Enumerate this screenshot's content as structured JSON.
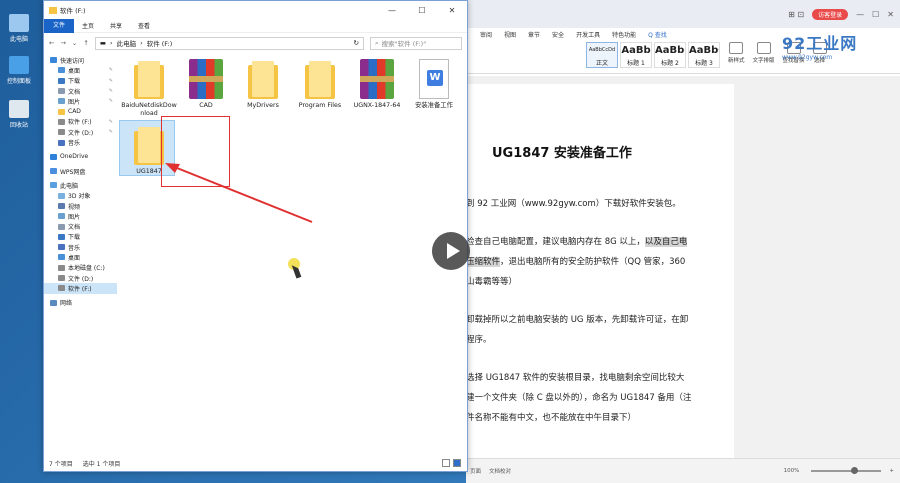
{
  "desktop": {
    "icons": [
      {
        "label": "此电脑",
        "color": "#9cc7ef"
      },
      {
        "label": "控制面板",
        "color": "#4aa0e6"
      },
      {
        "label": "回收站",
        "color": "#dfe8ef"
      }
    ]
  },
  "explorer": {
    "title": "软件 (F:)",
    "window_controls": [
      "—",
      "☐",
      "✕"
    ],
    "ribbon_tabs": [
      "文件",
      "主页",
      "共享",
      "查看"
    ],
    "breadcrumb": [
      "此电脑",
      "软件 (F:)"
    ],
    "search_placeholder": "搜索\"软件 (F:)\"",
    "nav": [
      {
        "label": "快速访问",
        "color": "#3a86d8",
        "indent": 0,
        "pinned": false
      },
      {
        "label": "桌面",
        "color": "#4a90d9",
        "indent": 1,
        "pinned": true
      },
      {
        "label": "下载",
        "color": "#3a78c4",
        "indent": 1,
        "pinned": true
      },
      {
        "label": "文档",
        "color": "#8a9ab0",
        "indent": 1,
        "pinned": true
      },
      {
        "label": "图片",
        "color": "#6aa0d0",
        "indent": 1,
        "pinned": true
      },
      {
        "label": "CAD",
        "color": "#f6c445",
        "indent": 1,
        "pinned": false
      },
      {
        "label": "软件 (F:)",
        "color": "#8a8a8a",
        "indent": 1,
        "pinned": true
      },
      {
        "label": "文件 (D:)",
        "color": "#8a8a8a",
        "indent": 1,
        "pinned": true
      },
      {
        "label": "音乐",
        "color": "#4a70c0",
        "indent": 1,
        "pinned": false
      },
      {
        "label": "OneDrive",
        "color": "#2f80d8",
        "indent": 0,
        "pinned": false
      },
      {
        "label": "WPS网盘",
        "color": "#4a8fe0",
        "indent": 0,
        "pinned": false
      },
      {
        "label": "此电脑",
        "color": "#5aa0e0",
        "indent": 0,
        "pinned": false
      },
      {
        "label": "3D 对象",
        "color": "#7ab0e0",
        "indent": 1,
        "pinned": false
      },
      {
        "label": "视频",
        "color": "#5a7ab0",
        "indent": 1,
        "pinned": false
      },
      {
        "label": "图片",
        "color": "#6aa0d0",
        "indent": 1,
        "pinned": false
      },
      {
        "label": "文档",
        "color": "#8a9ab0",
        "indent": 1,
        "pinned": false
      },
      {
        "label": "下载",
        "color": "#3a78c4",
        "indent": 1,
        "pinned": false
      },
      {
        "label": "音乐",
        "color": "#4a70c0",
        "indent": 1,
        "pinned": false
      },
      {
        "label": "桌面",
        "color": "#4a90d9",
        "indent": 1,
        "pinned": false
      },
      {
        "label": "本地磁盘 (C:)",
        "color": "#8a8a8a",
        "indent": 1,
        "pinned": false
      },
      {
        "label": "文件 (D:)",
        "color": "#8a8a8a",
        "indent": 1,
        "pinned": false
      },
      {
        "label": "软件 (F:)",
        "color": "#8a8a8a",
        "indent": 1,
        "pinned": false,
        "selected": true
      },
      {
        "label": "网络",
        "color": "#5a8ac0",
        "indent": 0,
        "pinned": false
      }
    ],
    "files": [
      {
        "label": "BaiduNetdiskDownload",
        "kind": "folder"
      },
      {
        "label": "CAD",
        "kind": "rar"
      },
      {
        "label": "MyDrivers",
        "kind": "folder"
      },
      {
        "label": "Program Files",
        "kind": "folder"
      },
      {
        "label": "UGNX-1847-64",
        "kind": "rar"
      },
      {
        "label": "安装准备工作",
        "kind": "docx"
      },
      {
        "label": "UG1847",
        "kind": "folder",
        "selected": true
      }
    ],
    "status": {
      "count": "7 个项目",
      "selected": "选中 1 个项目"
    }
  },
  "wps": {
    "login": "访客登录",
    "menu": [
      "审阅",
      "视图",
      "章节",
      "安全",
      "开发工具",
      "特色功能",
      "Q 查找"
    ],
    "styles": [
      {
        "preview": "AaBbCcDd",
        "name": "正文"
      },
      {
        "preview": "AaBb",
        "name": "标题 1"
      },
      {
        "preview": "AaBb(",
        "name": "标题 2"
      },
      {
        "preview": "AaBbC",
        "name": "标题 3"
      }
    ],
    "ribbon_tools": [
      "新样式",
      "文字排版",
      "查找替换",
      "选择"
    ],
    "logo": {
      "main": "92工业网",
      "sub": "www.92gyw.com"
    },
    "document": {
      "title": "UG1847 安装准备工作",
      "paragraphs": [
        {
          "lines": [
            "到 92 工业网（www.92gyw.com）下载好软件安装包。"
          ]
        },
        {
          "lines": [
            "检查自己电脑配置，建议电脑内存在 8G 以上，以及自己电",
            "压缩软件，退出电脑所有的安全防护软件（QQ 管家，360",
            "山毒霸等等）"
          ],
          "highlight_segment": "以及自己电",
          "highlight_line2": "压缩软件"
        },
        {
          "lines": [
            "卸载掉所以之前电脑安装的 UG 版本，先卸载许可证，在卸",
            "程序。"
          ]
        },
        {
          "lines": [
            "选择 UG1847 软件的安装根目录，找电脑剩余空间比较大",
            "建一个文件夹（除 C 盘以外的），命名为 UG1847 备用（注",
            "件名称不能有中文，也不能放在中午目录下）"
          ]
        }
      ]
    },
    "status": {
      "items": [
        "页面",
        "文档校对"
      ],
      "zoom": "100%"
    }
  },
  "arrow": {
    "color": "#e03030"
  }
}
